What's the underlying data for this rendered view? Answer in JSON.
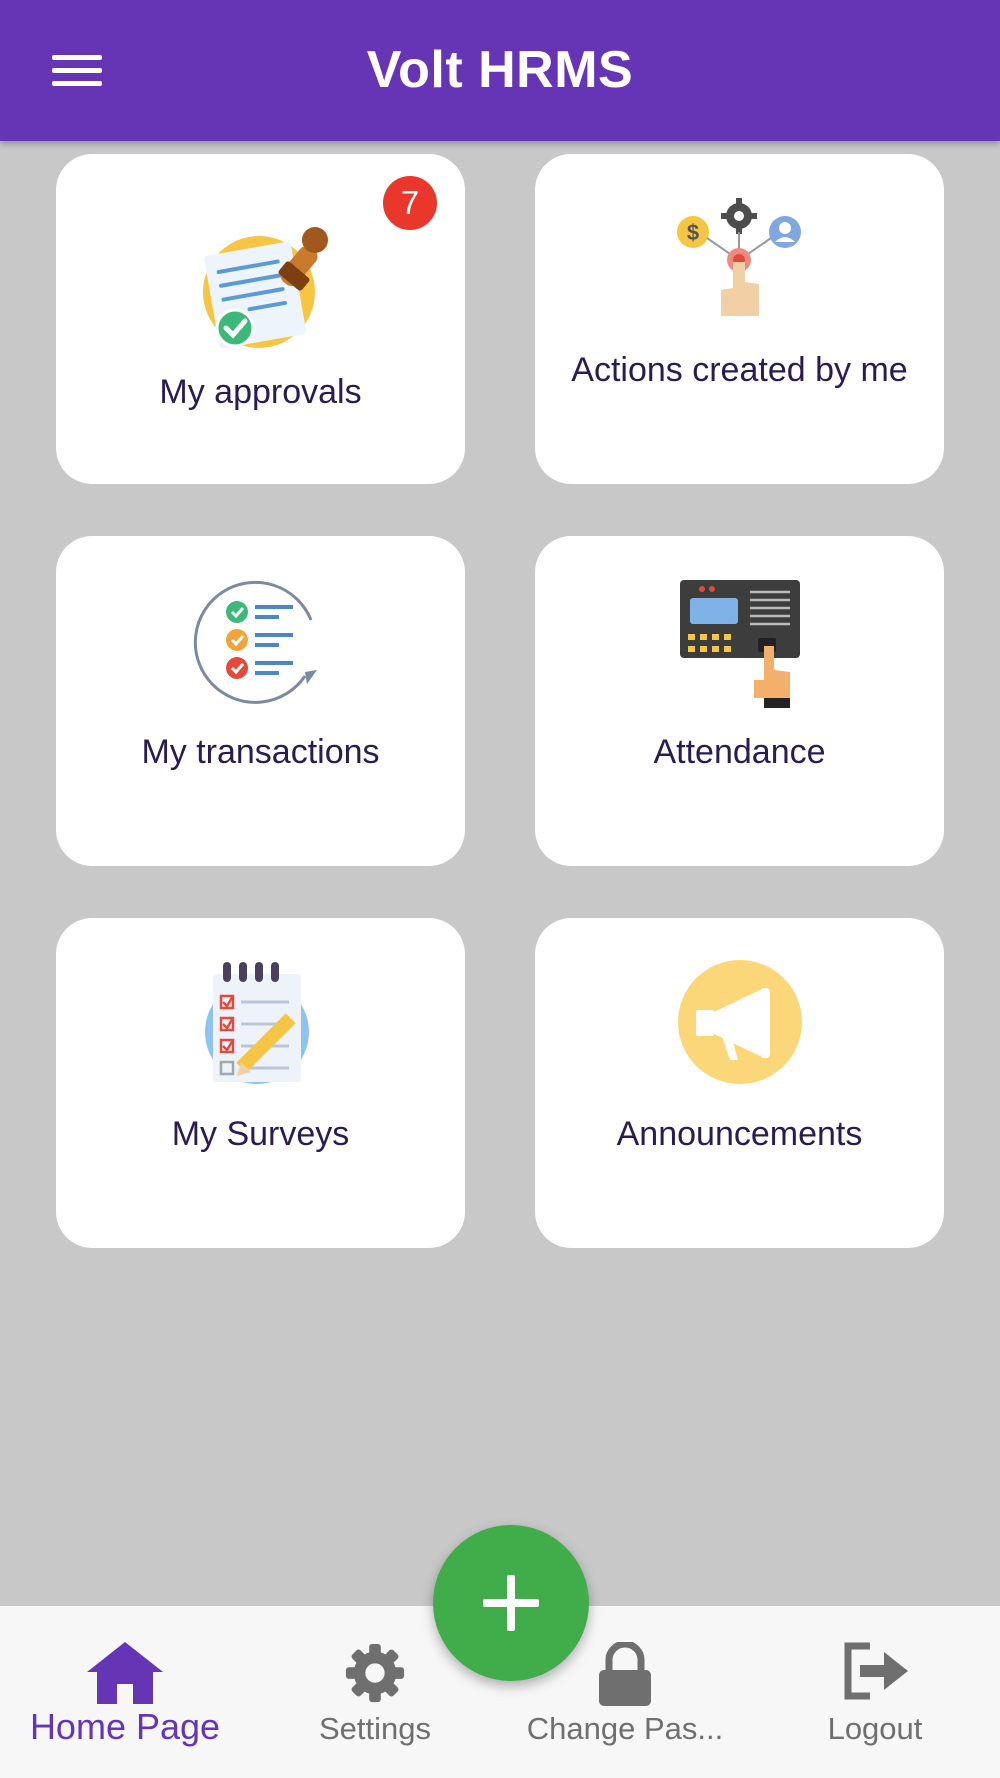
{
  "app": {
    "title": "Volt HRMS"
  },
  "cards": [
    {
      "label": "My approvals",
      "badge": "7",
      "icon": "approval-stamp-icon"
    },
    {
      "label": "Actions created by me",
      "icon": "actions-network-icon"
    },
    {
      "label": "My transactions",
      "icon": "checklist-icon"
    },
    {
      "label": "Attendance",
      "icon": "fingerprint-terminal-icon"
    },
    {
      "label": "My Surveys",
      "icon": "survey-notepad-icon"
    },
    {
      "label": "Announcements",
      "icon": "megaphone-icon"
    }
  ],
  "bottom_nav": [
    {
      "label": "Home Page",
      "icon": "home-icon",
      "active": true
    },
    {
      "label": "Settings",
      "icon": "gear-icon",
      "active": false
    },
    {
      "label": "Change Pas...",
      "icon": "lock-icon",
      "active": false
    },
    {
      "label": "Logout",
      "icon": "logout-icon",
      "active": false
    }
  ],
  "fab": {
    "icon": "plus-icon"
  },
  "colors": {
    "primary": "#6535b6",
    "fab": "#40ac4a",
    "badge": "#e9372c",
    "background": "#c8c8c8"
  }
}
